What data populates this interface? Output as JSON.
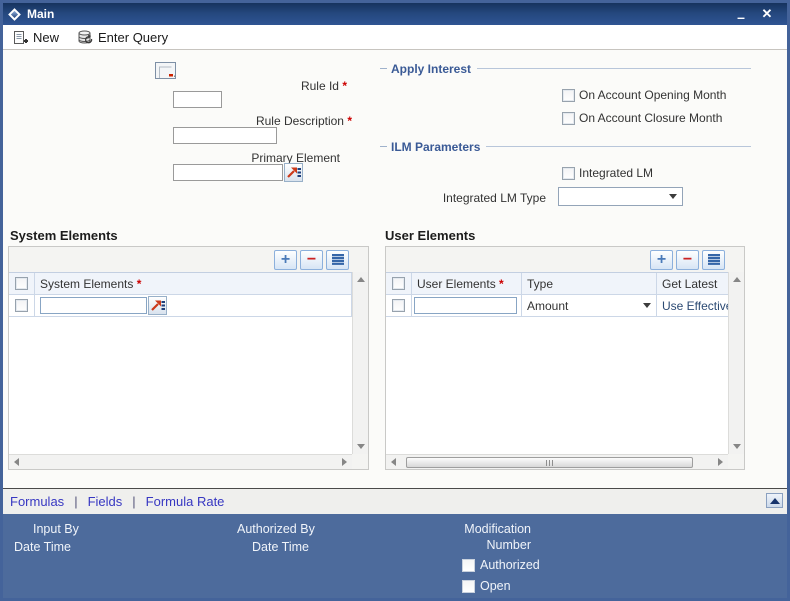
{
  "window": {
    "title": "Main",
    "minimize_glyph": "–",
    "close_glyph": "✕"
  },
  "toolbar": {
    "new_label": "New",
    "enter_query_label": "Enter Query"
  },
  "form": {
    "required_marker": "*",
    "rule_id": {
      "label": "Rule Id",
      "value": ""
    },
    "rule_description": {
      "label": "Rule Description",
      "value": ""
    },
    "primary_element": {
      "label": "Primary Element",
      "value": ""
    }
  },
  "apply_interest": {
    "title": "Apply Interest",
    "checkboxes": [
      {
        "label": "On Account Opening Month",
        "checked": false
      },
      {
        "label": "On Account Closure Month",
        "checked": false
      }
    ]
  },
  "ilm_parameters": {
    "title": "ILM Parameters",
    "integrated_lm": {
      "label": "Integrated LM",
      "checked": false
    },
    "integrated_lm_type": {
      "label": "Integrated LM Type",
      "value": ""
    }
  },
  "system_elements": {
    "title": "System Elements",
    "toolbar": {
      "add_glyph": "+",
      "remove_glyph": "−"
    },
    "columns": [
      {
        "label": "System Elements",
        "required": "*"
      }
    ],
    "row": {
      "value": ""
    }
  },
  "user_elements": {
    "title": "User Elements",
    "toolbar": {
      "add_glyph": "+",
      "remove_glyph": "−"
    },
    "columns": [
      {
        "label": "User Elements",
        "required": "*"
      },
      {
        "label": "Type"
      },
      {
        "label": "Get Latest"
      }
    ],
    "row": {
      "user_element_value": "",
      "type_value": "Amount",
      "get_latest_value": "Use Effective"
    }
  },
  "tabs": [
    {
      "label": "Formulas"
    },
    {
      "label": "Fields"
    },
    {
      "label": "Formula Rate"
    }
  ],
  "tab_separator": "|",
  "footer": {
    "input_by_label": "Input By",
    "input_date_time_label": "Date Time",
    "authorized_by_label": "Authorized By",
    "authorized_date_time_label": "Date Time",
    "modification_label_line1": "Modification",
    "modification_label_line2": "Number",
    "authorized_checkbox_label": "Authorized",
    "open_checkbox_label": "Open"
  },
  "colors": {
    "titlebar_top": "#16335e",
    "titlebar_bottom": "#2f5493",
    "window_border": "#44639a",
    "footer_background": "#4d6b9c",
    "section_title": "#3a5a96",
    "link": "#3737c2",
    "required": "#cc0000",
    "grid_header_background": "#f0f4fa"
  }
}
